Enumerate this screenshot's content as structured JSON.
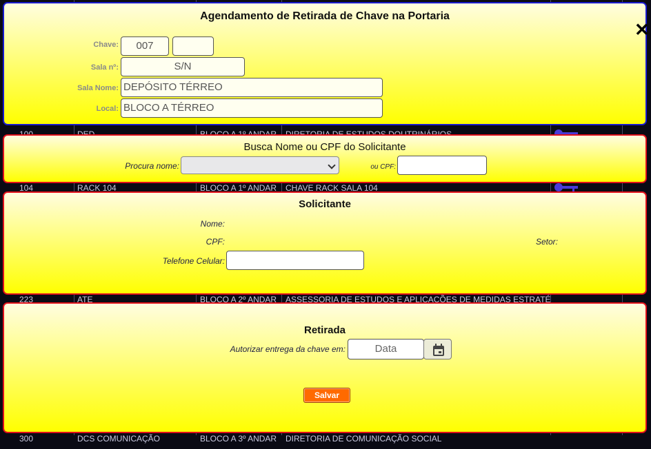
{
  "background_rows": [
    {
      "num": "100",
      "name": "DED",
      "local": "BLOCO A 1º ANDAR",
      "desc": "DIRETORIA DE ESTUDOS DOUTRINÁRIOS"
    },
    {
      "num": "104",
      "name": "RACK 104",
      "local": "BLOCO A 1º ANDAR",
      "desc": "CHAVE RACK SALA 104"
    },
    {
      "num": "223",
      "name": "ATE",
      "local": "BLOCO A 2º ANDAR",
      "desc": "ASSESSORIA DE ESTUDOS E APLICAÇÕES DE MEDIDAS ESTRATÉGICAS"
    },
    {
      "num": "300",
      "name": "DCS COMUNICAÇÃO",
      "local": "BLOCO A 3º ANDAR",
      "desc": "DIRETORIA DE COMUNICAÇÃO SOCIAL"
    }
  ],
  "header": {
    "title": "Agendamento de Retirada de Chave na Portaria",
    "close_icon": "close-icon"
  },
  "chave": {
    "label": "Chave:",
    "value1": "007",
    "value2": "",
    "sala_label": "Sala nº:",
    "sala_value": "S/N",
    "sala_nome_label": "Sala Nome:",
    "sala_nome_value": "DEPÓSITO TÉRREO",
    "local_label": "Local:",
    "local_value": "BLOCO A TÉRREO"
  },
  "busca": {
    "title": "Busca Nome ou CPF do Solicitante",
    "procura_label": "Procura nome:",
    "procura_selected": "",
    "cpf_label": "ou CPF:",
    "cpf_value": ""
  },
  "solicitante": {
    "title": "Solicitante",
    "nome_label": "Nome:",
    "cpf_label": "CPF:",
    "setor_label": "Setor:",
    "telefone_label": "Telefone Celular:",
    "telefone_value": ""
  },
  "retirada": {
    "title": "Retirada",
    "autorizar_label": "Autorizar entrega da chave em:",
    "data_placeholder": "Data",
    "calendar_icon": "calendar-icon",
    "save_label": "Salvar"
  },
  "colors": {
    "panel_top": "#fffde0",
    "panel_bottom": "#ffff00",
    "header_border": "#1a1ad0",
    "panel_border": "#e0101a",
    "save_button": "#ff6a00"
  }
}
